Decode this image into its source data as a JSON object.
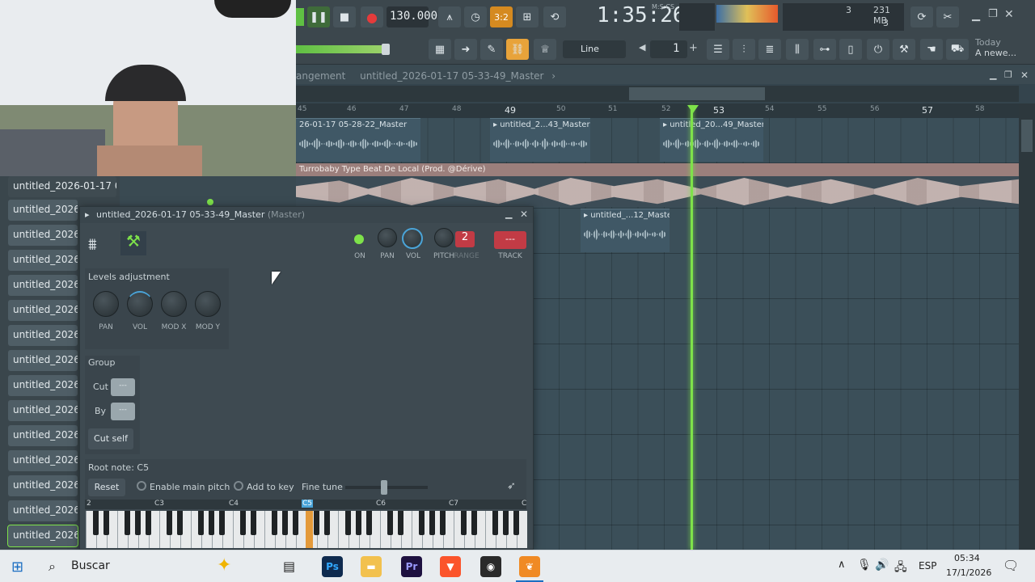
{
  "toolbar": {
    "tempo": "130.000",
    "time": "1:35:26",
    "time_mode": "M:S:CS",
    "pattern_num": "3:2",
    "cpu_label": "3",
    "mem_label": "231 MB",
    "poly_label": "3",
    "snap": "Line",
    "pattern_value": "1",
    "hint_top": "Today",
    "hint_bottom": "A newe..."
  },
  "playlist": {
    "title_prefix": "angement",
    "title": "untitled_2026-01-17 05-33-49_Master",
    "ruler": [
      "45",
      "46",
      "47",
      "48",
      "49",
      "50",
      "51",
      "52",
      "53",
      "54",
      "55",
      "56",
      "57",
      "58"
    ],
    "clips": [
      {
        "name": "26-01-17 05-28-22_Master"
      },
      {
        "name": "untitled_2...43_Master"
      },
      {
        "name": "untitled_20...49_Master"
      },
      {
        "name": "untitled_...12_Master"
      }
    ],
    "audio_track": "Turrobaby Type Beat  De Local (Prod. @Dérive)"
  },
  "browser": {
    "items": [
      "untitled_2026-01-17 05-...",
      "untitled_2026-0",
      "untitled_2026-0",
      "untitled_2026-0",
      "untitled_2026-0",
      "untitled_2026-0",
      "untitled_2026-0",
      "untitled_2026-0",
      "untitled_2026-0",
      "untitled_2026-0",
      "untitled_2026-0",
      "untitled_2026-0",
      "untitled_2026-0",
      "untitled_2026-0",
      "untitled_2026-0"
    ]
  },
  "channel": {
    "title": "untitled_2026-01-17 05-33-49_Master",
    "title_suffix": "(Master)",
    "on": "ON",
    "pan": "PAN",
    "vol": "VOL",
    "pitch": "PITCH",
    "range": "RANGE",
    "track": "TRACK",
    "range_value": "2",
    "track_value": "---",
    "levels_title": "Levels adjustment",
    "knobs": [
      "PAN",
      "VOL",
      "MOD X",
      "MOD Y"
    ],
    "group_title": "Group",
    "cut": "Cut",
    "by": "By",
    "cut_value": "---",
    "by_value": "---",
    "cut_self": "Cut self",
    "root_note": "Root note: C5",
    "reset": "Reset",
    "enable_main_pitch": "Enable main pitch",
    "add_to_key": "Add to key",
    "fine_tune": "Fine tune",
    "octaves": [
      "2",
      "C3",
      "C4",
      "C5",
      "C6",
      "C7",
      "C"
    ]
  },
  "taskbar": {
    "search": "Buscar",
    "lang": "ESP",
    "time": "05:34",
    "date": "17/1/2026"
  }
}
